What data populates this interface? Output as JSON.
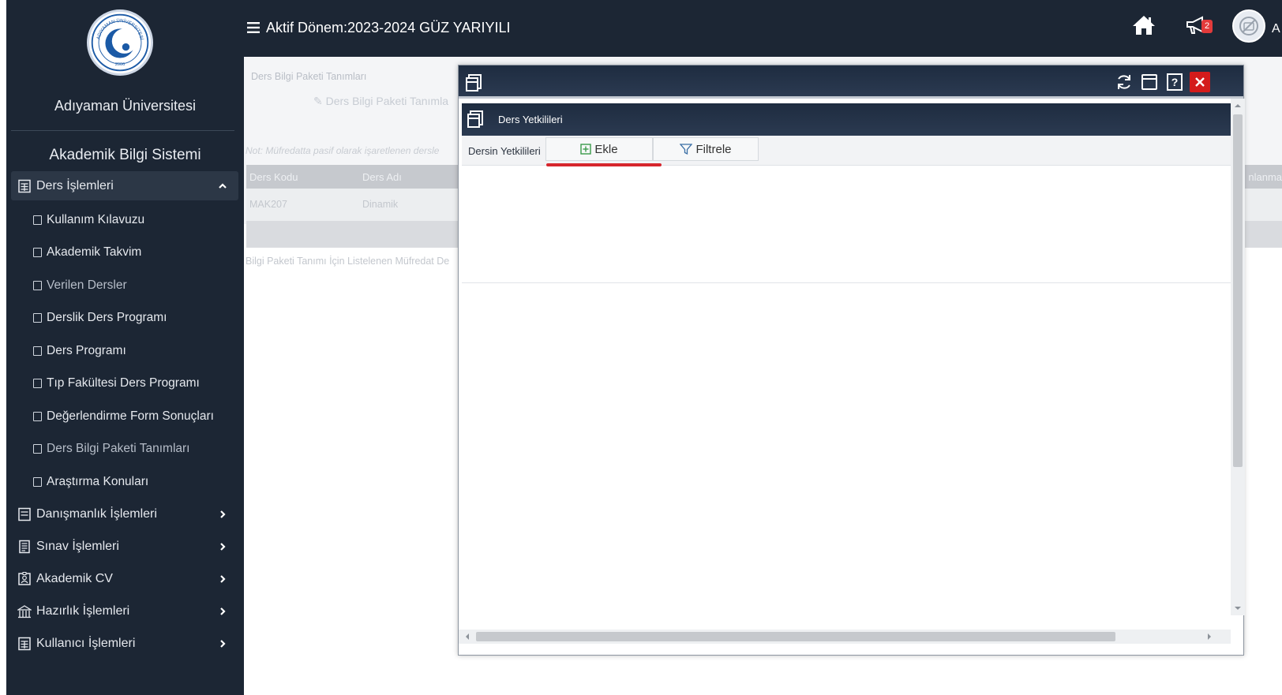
{
  "sidebar": {
    "university_name": "Adıyaman Üniversitesi",
    "system_name": "Akademik Bilgi Sistemi",
    "logo_text": [
      "ADIYAMAN ÜNİVERSİTESİ",
      "2006"
    ],
    "sections": {
      "ders": {
        "label": "Ders İşlemleri",
        "icon": "calculator-icon",
        "expanded": true
      },
      "danismanlik": {
        "label": "Danışmanlık İşlemleri",
        "icon": "list-icon"
      },
      "sinav": {
        "label": "Sınav İşlemleri",
        "icon": "document-list-icon"
      },
      "cv": {
        "label": "Akademik CV",
        "icon": "id-card-icon"
      },
      "hazirlik": {
        "label": "Hazırlık İşlemleri",
        "icon": "building-icon"
      },
      "kullanici": {
        "label": "Kullanıcı İşlemleri",
        "icon": "calculator-icon"
      }
    },
    "sub_items": [
      "Kullanım Kılavuzu",
      "Akademik Takvim",
      "Verilen Dersler",
      "Derslik Ders Programı",
      "Ders Programı",
      "Tıp Fakültesi Ders Programı",
      "Değerlendirme Form Sonuçları",
      "Ders Bilgi Paketi Tanımları",
      "Araştırma Konuları"
    ]
  },
  "topbar": {
    "period": "Aktif Dönem:2023-2024 GÜZ YARIYILI",
    "notification_count": "2",
    "user_clip": "A"
  },
  "background": {
    "breadcrumb": "Ders Bilgi Paketi Tanımları",
    "title": "Ders Bilgi Paketi Tanımla",
    "note": "Not: Müfredatta pasif olarak işaretlenen dersle",
    "col_code": "Ders Kodu",
    "col_name": "Ders Adı",
    "col_right": "nlanma",
    "row_code": "MAK207",
    "row_name": "Dinamik",
    "list_text": "Bilgi Paketi Tanımı İçin Listelenen Müfredat De"
  },
  "modal": {
    "panel_title": "Ders Yetkilileri",
    "toolbar_label": "Dersin Yetkilileri",
    "add_label": "Ekle",
    "filter_label": "Filtrele"
  },
  "colors": {
    "sidebar_bg": "#1c2634",
    "modal_header": "#24334a",
    "close_red": "#d41b1b",
    "underline_red": "#d6262d",
    "badge_red": "#e23b3b"
  }
}
